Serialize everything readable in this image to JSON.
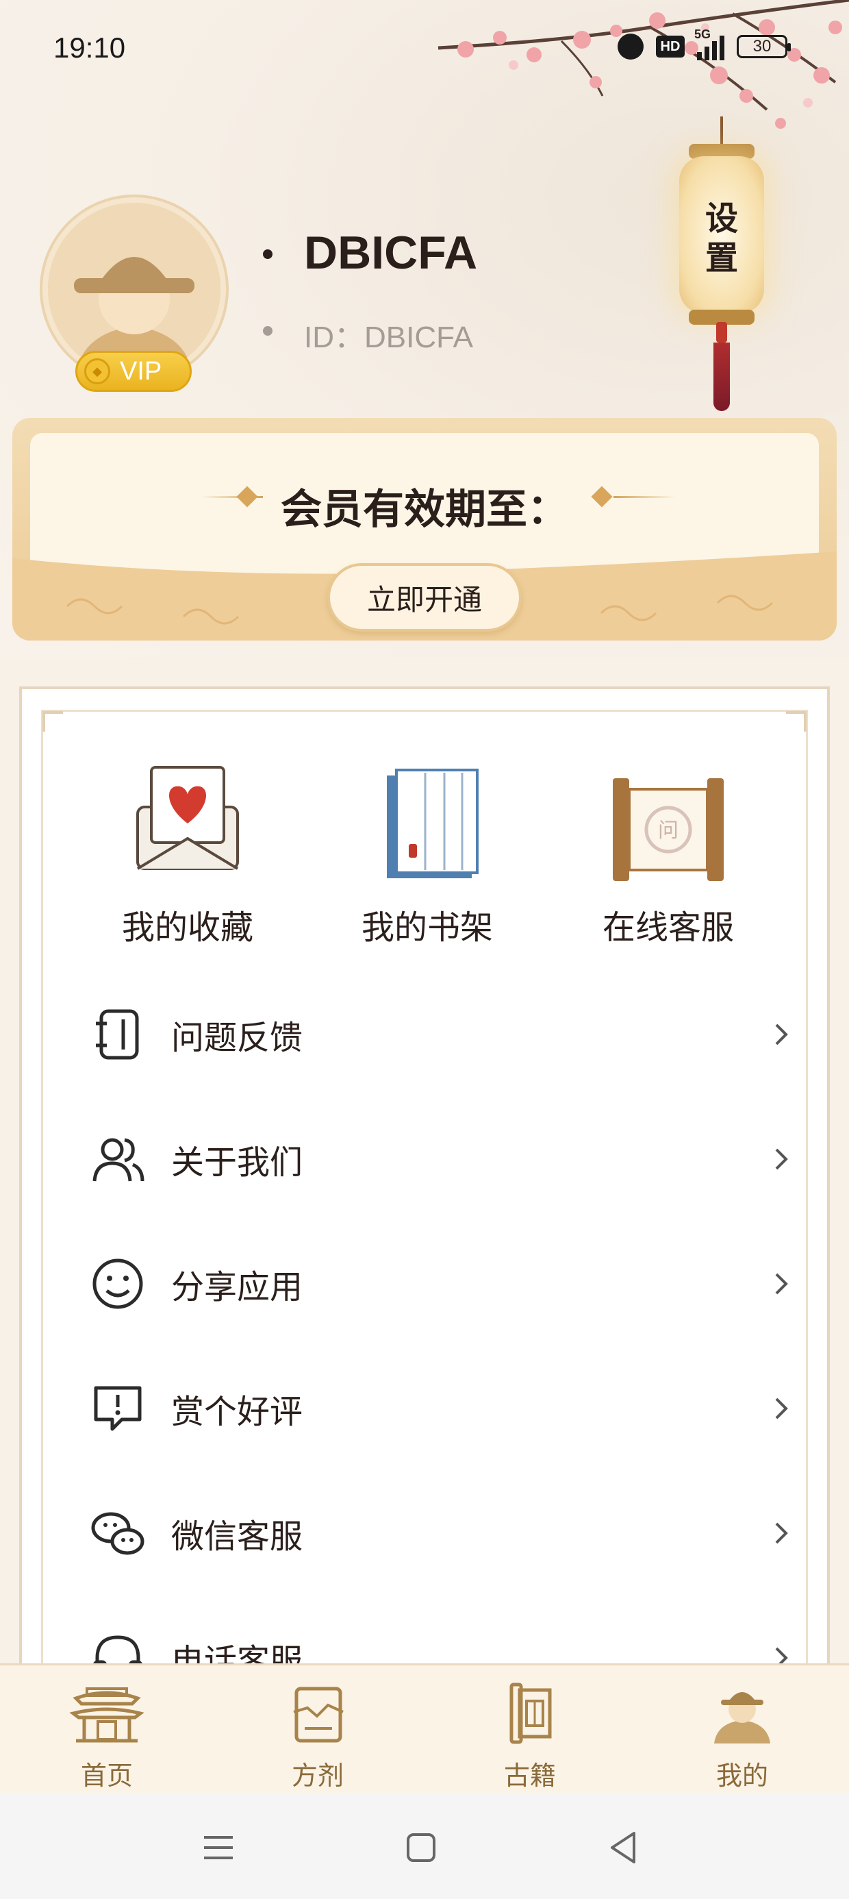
{
  "status_bar": {
    "time": "19:10",
    "hd_label": "HD",
    "network_label": "5G",
    "battery": "30"
  },
  "profile": {
    "username": "DBICFA",
    "user_id": "ID：DBICFA",
    "vip_label": "VIP"
  },
  "lantern": {
    "label_line1": "设",
    "label_line2": "置"
  },
  "membership": {
    "title": "会员有效期至：",
    "button_label": "立即开通"
  },
  "quick_actions": [
    {
      "label": "我的收藏",
      "icon": "envelope-heart-icon"
    },
    {
      "label": "我的书架",
      "icon": "book-icon"
    },
    {
      "label": "在线客服",
      "icon": "scroll-icon"
    }
  ],
  "menu_items": [
    {
      "label": "问题反馈",
      "icon": "feedback-notebook-icon"
    },
    {
      "label": "关于我们",
      "icon": "users-icon"
    },
    {
      "label": "分享应用",
      "icon": "smile-icon"
    },
    {
      "label": "赏个好评",
      "icon": "speech-alert-icon"
    },
    {
      "label": "微信客服",
      "icon": "wechat-icon"
    },
    {
      "label": "电话客服",
      "icon": "headphones-icon"
    }
  ],
  "bottom_nav": [
    {
      "label": "首页",
      "icon": "palace-icon"
    },
    {
      "label": "方剂",
      "icon": "prescription-icon"
    },
    {
      "label": "古籍",
      "icon": "ancient-book-icon"
    },
    {
      "label": "我的",
      "icon": "scholar-avatar-icon"
    }
  ],
  "colors": {
    "accent_gold": "#d9a55a",
    "vip_yellow": "#f3c232",
    "nav_text": "#8a6a3a"
  }
}
